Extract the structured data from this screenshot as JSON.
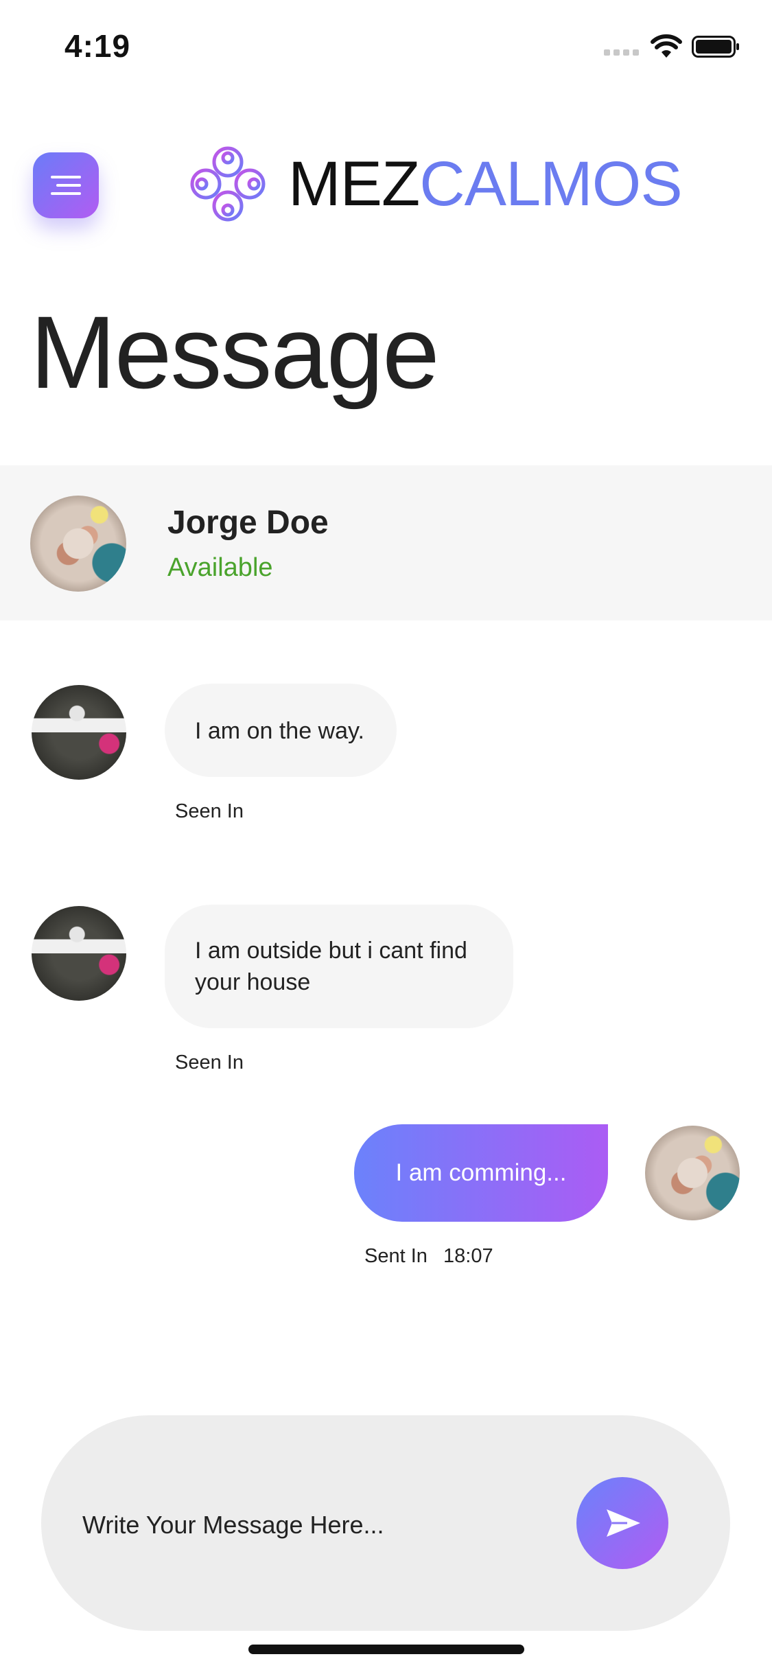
{
  "status_bar": {
    "time": "4:19"
  },
  "header": {
    "brand_part1": "MEZ",
    "brand_part2": "CALMOS"
  },
  "page": {
    "title": "Message"
  },
  "contact": {
    "name": "Jorge Doe",
    "status": "Available"
  },
  "messages": [
    {
      "direction": "received",
      "text": "I am on the way.",
      "status_label": "Seen In"
    },
    {
      "direction": "received",
      "text": "I am outside but i cant find your house",
      "status_label": "Seen In"
    },
    {
      "direction": "sent",
      "text": "I am comming...",
      "status_label": "Sent In",
      "time": "18:07"
    }
  ],
  "composer": {
    "placeholder": "Write Your Message Here..."
  },
  "colors": {
    "accent_start": "#6b82fb",
    "accent_end": "#b15cf2",
    "available": "#4aa32c",
    "brand_blue": "#6b7cf0"
  }
}
